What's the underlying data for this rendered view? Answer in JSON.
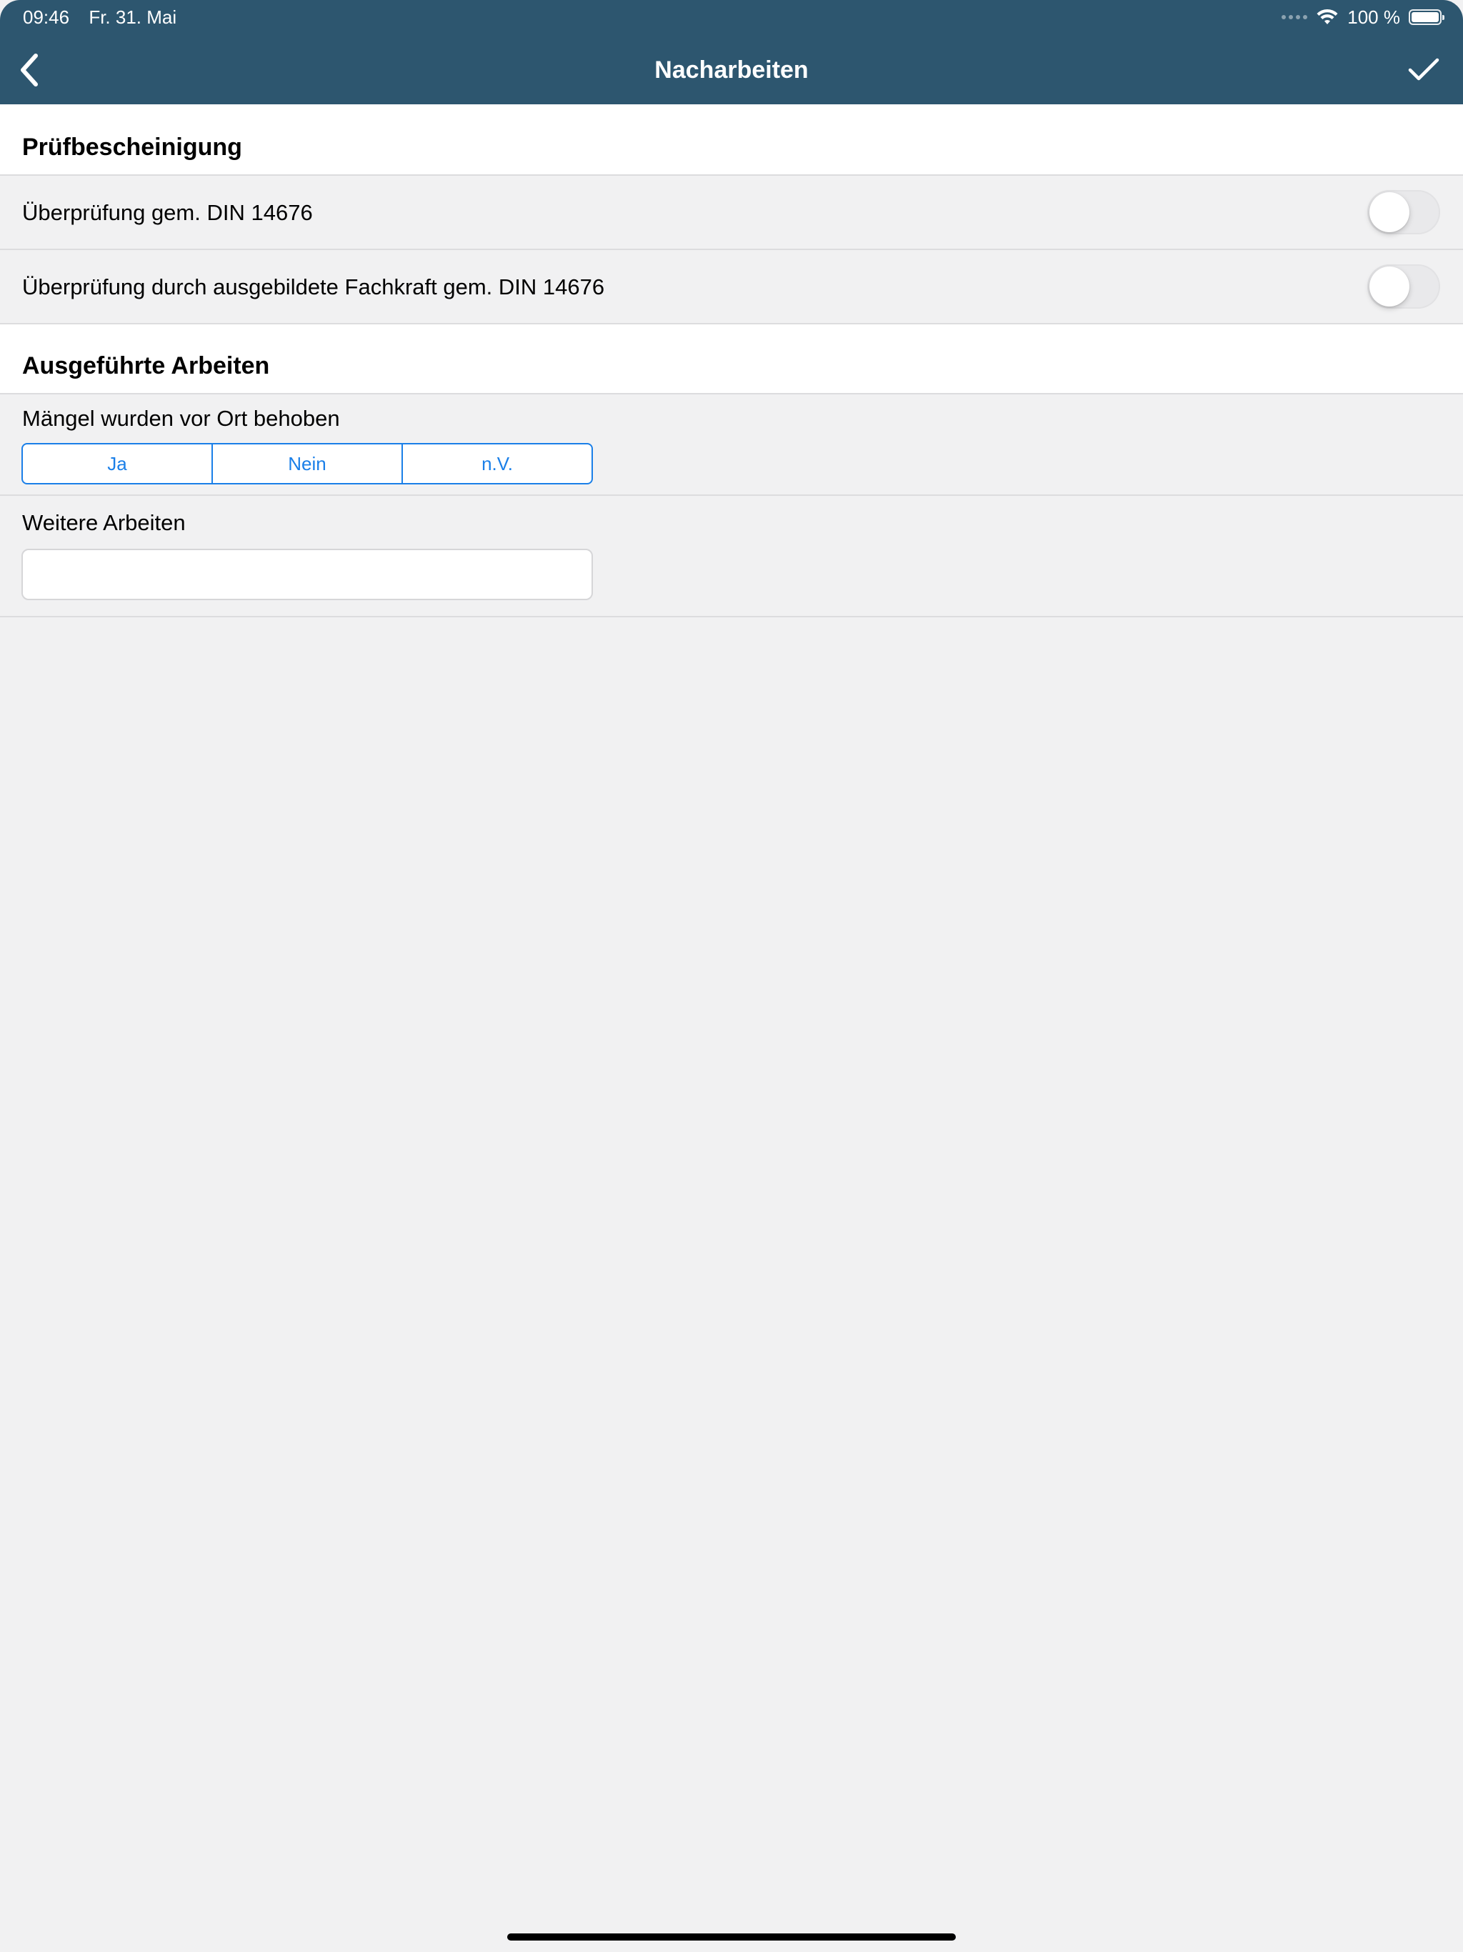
{
  "status_bar": {
    "time": "09:46",
    "date": "Fr. 31. Mai",
    "battery_text": "100 %"
  },
  "nav": {
    "title": "Nacharbeiten",
    "back_icon": "chevron-left-icon",
    "done_icon": "checkmark-icon"
  },
  "sections": {
    "pruefbescheinigung": {
      "title": "Prüfbescheinigung",
      "rows": [
        {
          "label": "Überprüfung gem. DIN 14676",
          "toggle_on": false
        },
        {
          "label": "Überprüfung durch ausgebildete Fachkraft gem. DIN 14676",
          "toggle_on": false
        }
      ]
    },
    "ausgefuehrte_arbeiten": {
      "title": "Ausgeführte Arbeiten",
      "maengel": {
        "label": "Mängel wurden vor Ort behoben",
        "options": [
          "Ja",
          "Nein",
          "n.V."
        ]
      },
      "weitere": {
        "label": "Weitere Arbeiten",
        "value": "",
        "placeholder": ""
      }
    }
  },
  "colors": {
    "header": "#2d566f",
    "accent": "#1a7fe8",
    "background": "#f1f1f2"
  }
}
